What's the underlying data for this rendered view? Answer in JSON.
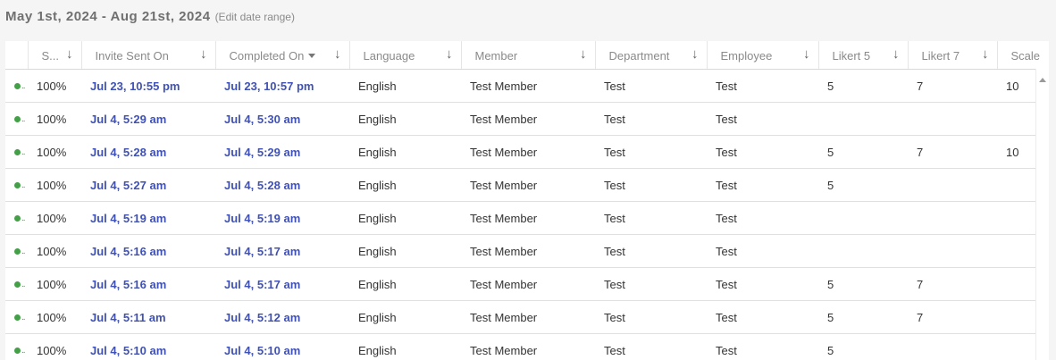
{
  "header": {
    "date_range": "May 1st, 2024 - Aug 21st, 2024",
    "edit_link": "(Edit date range)"
  },
  "columns": [
    {
      "label": "S...",
      "sort": "↓"
    },
    {
      "label": "Invite Sent On",
      "sort": "↓"
    },
    {
      "label": "Completed On",
      "sort": "↓",
      "active_sort": true
    },
    {
      "label": "Language",
      "sort": "↓"
    },
    {
      "label": "Member",
      "sort": "↓"
    },
    {
      "label": "Department",
      "sort": "↓"
    },
    {
      "label": "Employee",
      "sort": "↓"
    },
    {
      "label": "Likert 5",
      "sort": "↓"
    },
    {
      "label": "Likert 7",
      "sort": "↓"
    },
    {
      "label": "Scale"
    }
  ],
  "rows": [
    {
      "progress": "100%",
      "invite_sent": "Jul 23, 10:55 pm",
      "completed": "Jul 23, 10:57 pm",
      "language": "English",
      "member": "Test Member",
      "department": "Test",
      "employee": "Test",
      "likert5": "5",
      "likert7": "7",
      "scale": "10"
    },
    {
      "progress": "100%",
      "invite_sent": "Jul 4, 5:29 am",
      "completed": "Jul 4, 5:30 am",
      "language": "English",
      "member": "Test Member",
      "department": "Test",
      "employee": "Test",
      "likert5": "",
      "likert7": "",
      "scale": ""
    },
    {
      "progress": "100%",
      "invite_sent": "Jul 4, 5:28 am",
      "completed": "Jul 4, 5:29 am",
      "language": "English",
      "member": "Test Member",
      "department": "Test",
      "employee": "Test",
      "likert5": "5",
      "likert7": "7",
      "scale": "10"
    },
    {
      "progress": "100%",
      "invite_sent": "Jul 4, 5:27 am",
      "completed": "Jul 4, 5:28 am",
      "language": "English",
      "member": "Test Member",
      "department": "Test",
      "employee": "Test",
      "likert5": "5",
      "likert7": "",
      "scale": ""
    },
    {
      "progress": "100%",
      "invite_sent": "Jul 4, 5:19 am",
      "completed": "Jul 4, 5:19 am",
      "language": "English",
      "member": "Test Member",
      "department": "Test",
      "employee": "Test",
      "likert5": "",
      "likert7": "",
      "scale": ""
    },
    {
      "progress": "100%",
      "invite_sent": "Jul 4, 5:16 am",
      "completed": "Jul 4, 5:17 am",
      "language": "English",
      "member": "Test Member",
      "department": "Test",
      "employee": "Test",
      "likert5": "",
      "likert7": "",
      "scale": ""
    },
    {
      "progress": "100%",
      "invite_sent": "Jul 4, 5:16 am",
      "completed": "Jul 4, 5:17 am",
      "language": "English",
      "member": "Test Member",
      "department": "Test",
      "employee": "Test",
      "likert5": "5",
      "likert7": "7",
      "scale": ""
    },
    {
      "progress": "100%",
      "invite_sent": "Jul 4, 5:11 am",
      "completed": "Jul 4, 5:12 am",
      "language": "English",
      "member": "Test Member",
      "department": "Test",
      "employee": "Test",
      "likert5": "5",
      "likert7": "7",
      "scale": ""
    },
    {
      "progress": "100%",
      "invite_sent": "Jul 4, 5:10 am",
      "completed": "Jul 4, 5:10 am",
      "language": "English",
      "member": "Test Member",
      "department": "Test",
      "employee": "Test",
      "likert5": "5",
      "likert7": "",
      "scale": ""
    }
  ],
  "colors": {
    "status_complete": "#43a047",
    "date_link": "#3f51b5"
  }
}
